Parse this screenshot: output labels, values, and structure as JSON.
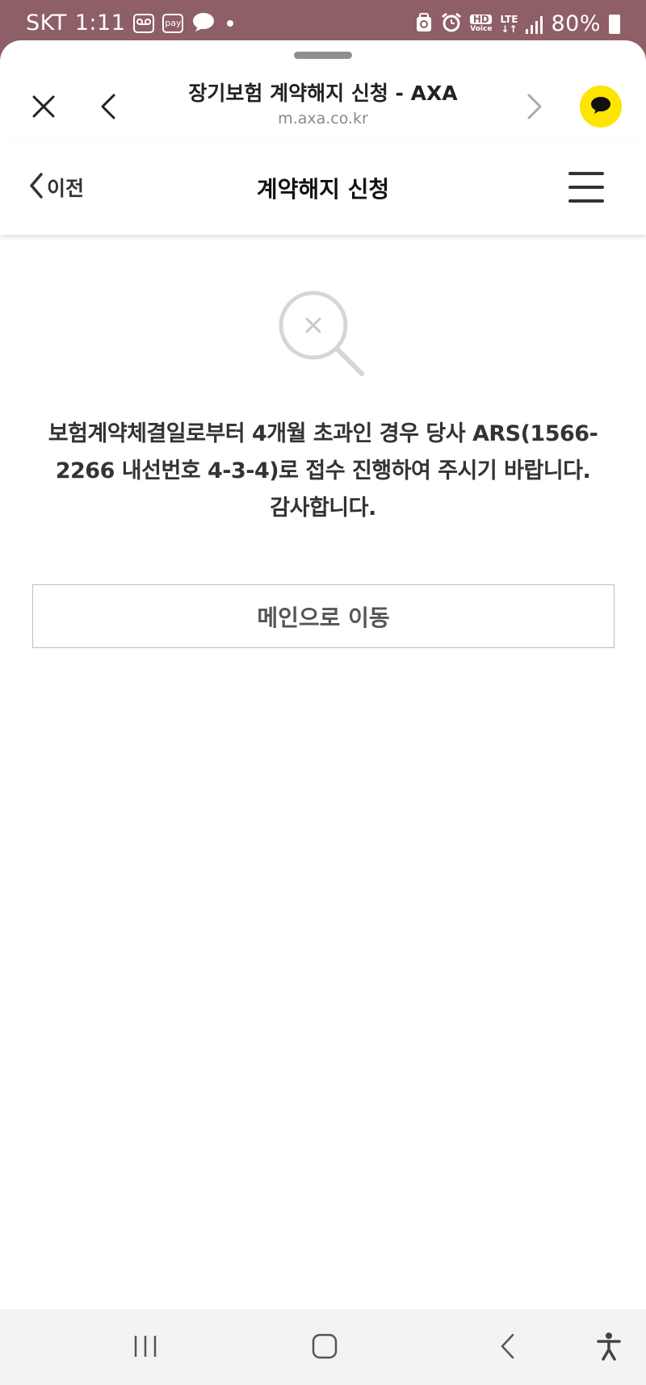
{
  "status_bar": {
    "carrier": "SKT",
    "time": "1:11",
    "pay_icon_label": "pay",
    "hd_label": "HD",
    "voice_label": "Voice",
    "lte_label": "LTE",
    "battery": "80%"
  },
  "browser": {
    "title": "장기보험 계약해지 신청 - AXA",
    "url": "m.axa.co.kr"
  },
  "header": {
    "back_label": "이전",
    "title": "계약해지 신청"
  },
  "content": {
    "message_line1": "보험계약체결일로부터 4개월 초과인 경우 당사 ARS(1566-",
    "message_line2": "2266 내선번호 4-3-4)로 접수 진행하여 주시기 바랍니다.",
    "message_line3": "감사합니다.",
    "main_button_label": "메인으로 이동"
  },
  "icons": {
    "close": "close-icon",
    "browser_back": "chevron-left-icon",
    "browser_forward": "chevron-right-icon",
    "kakao": "kakao-chat-icon",
    "menu": "hamburger-menu-icon",
    "no_result": "search-x-icon",
    "recents": "recents-icon",
    "home": "home-icon",
    "back": "back-icon",
    "accessibility": "accessibility-icon"
  },
  "colors": {
    "status_bar": "#8e5f67",
    "kakao_yellow": "#fee500",
    "text_primary": "#111111",
    "button_border": "#bdbdbd"
  }
}
